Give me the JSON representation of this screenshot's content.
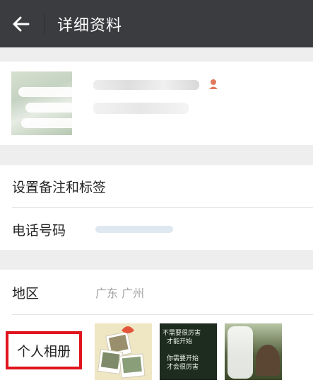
{
  "header": {
    "title": "详细资料",
    "back_icon": "arrow-left-icon"
  },
  "detail": {
    "remark_label": "设置备注和标签",
    "phone_label": "电话号码",
    "region_label": "地区",
    "region_value": "广东  广州",
    "album_label": "个人相册"
  },
  "album": {
    "thumb2_lines": [
      "不需要很厉害",
      "才能开始",
      "",
      "你需要开始",
      "才会很厉害"
    ]
  },
  "colors": {
    "highlight": "#e0141c",
    "topbar": "#3b3c3f",
    "phone": "#9ab4cf"
  }
}
